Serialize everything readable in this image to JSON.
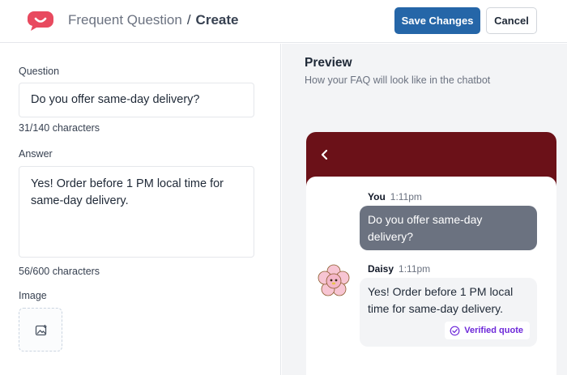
{
  "header": {
    "breadcrumb_parent": "Frequent Question",
    "breadcrumb_separator": "/",
    "breadcrumb_current": "Create",
    "save_label": "Save Changes",
    "cancel_label": "Cancel",
    "logo_icon": "smile-bubble-logo",
    "save_color": "#2566a8",
    "logo_color": "#e84a5f"
  },
  "form": {
    "question_label": "Question",
    "question_value": "Do you offer same-day delivery?",
    "question_counter": "31/140 characters",
    "answer_label": "Answer",
    "answer_value": "Yes! Order before 1 PM local time for same-day delivery.",
    "answer_counter": "56/600 characters",
    "image_label": "Image",
    "image_icon": "image-add-icon"
  },
  "preview": {
    "title": "Preview",
    "subtitle": "How your FAQ will look like in the chatbot",
    "header_color": "#6b1118",
    "back_icon": "chevron-left-icon",
    "messages": [
      {
        "sender": "You",
        "time": "1:11pm",
        "text": "Do you offer same-day delivery?"
      },
      {
        "sender": "Daisy",
        "time": "1:11pm",
        "text": "Yes! Order before 1 PM local time for same-day delivery."
      }
    ],
    "bot_avatar_icon": "flower-avatar",
    "verified_label": "Verified quote",
    "verified_icon": "check-badge-icon",
    "verified_color": "#6d28d9"
  }
}
